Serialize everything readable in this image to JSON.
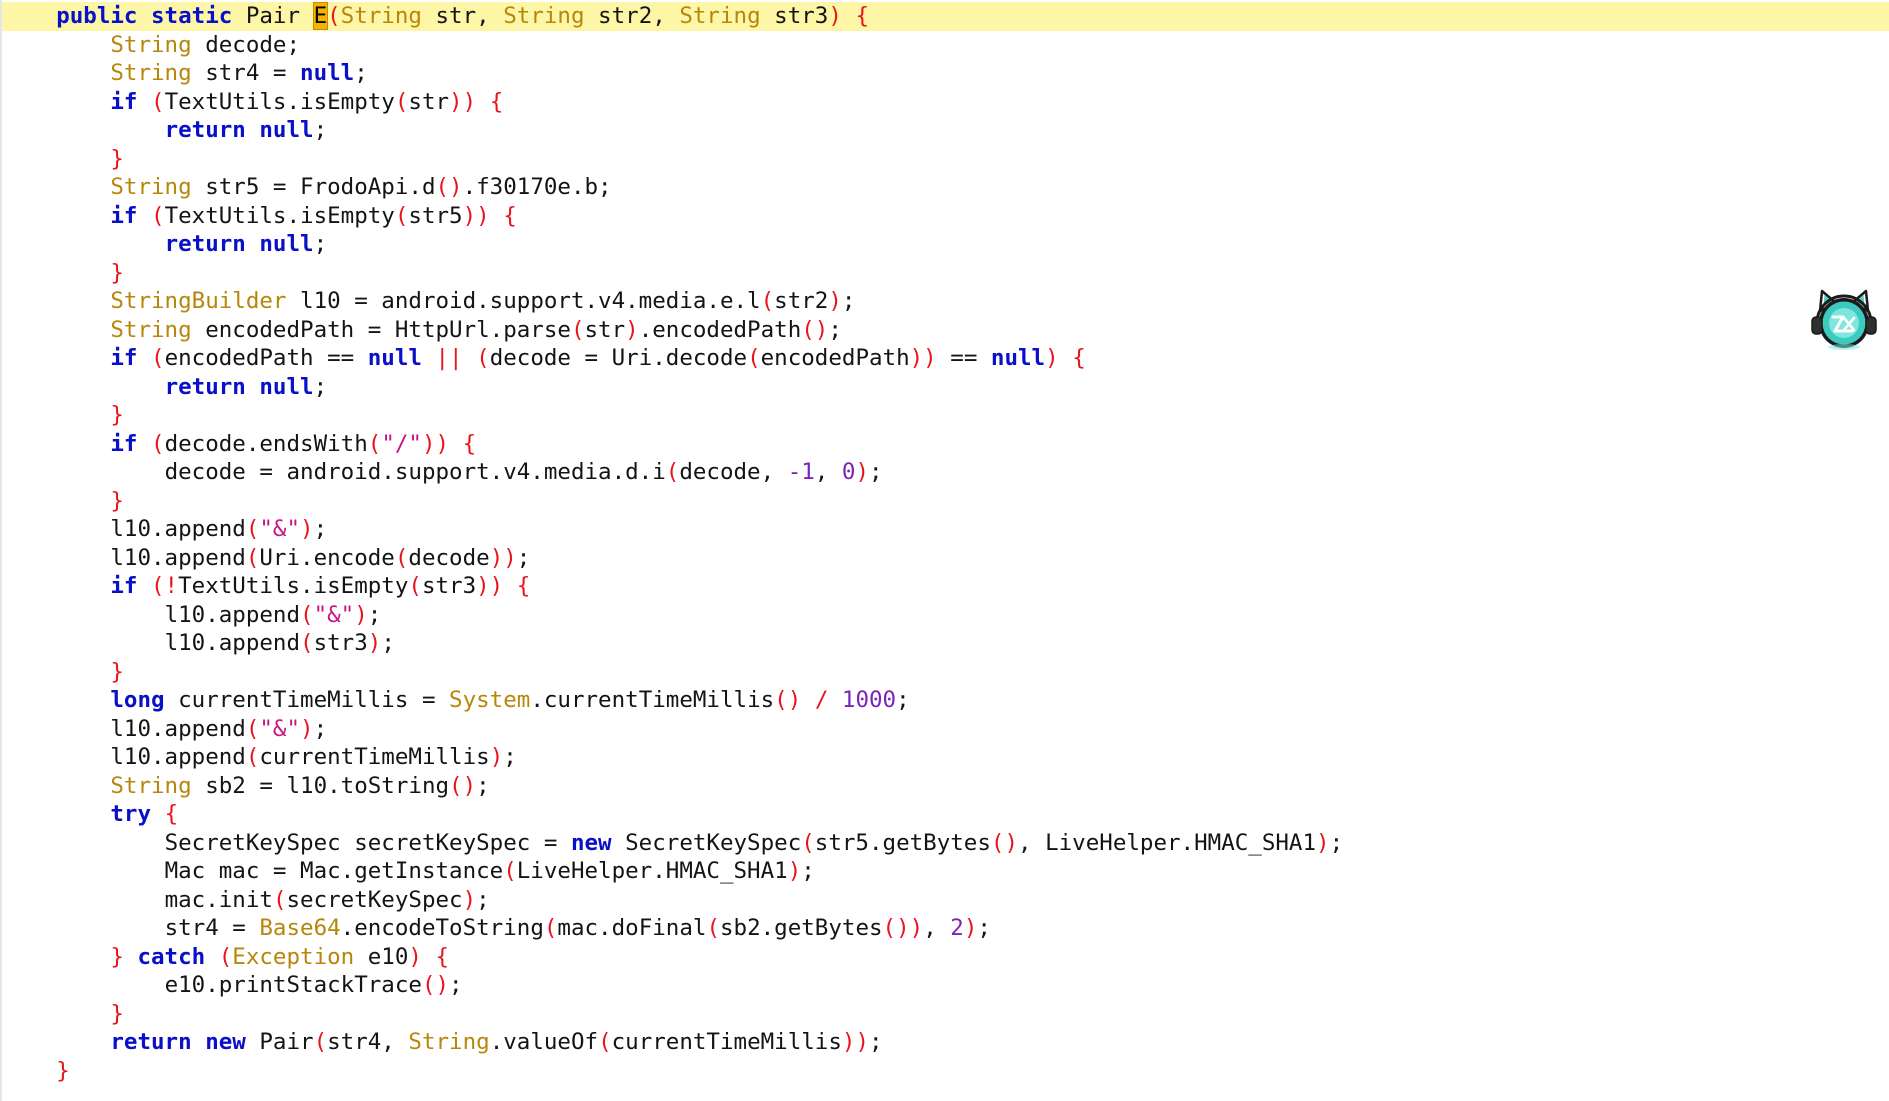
{
  "colors": {
    "keyword": "#0a10c8",
    "type": "#b8860b",
    "punctuation": "#e8141c",
    "string": "#c71585",
    "number": "#7b24b8",
    "identifier": "#141414",
    "current_line_highlight": "#fcf6a6",
    "cursor_match": "#f5b300"
  },
  "mascot": {
    "icon": "cat-headphones-logo-icon"
  },
  "lines": [
    {
      "hl": true,
      "tokens": [
        {
          "c": "sp",
          "t": "    "
        },
        {
          "c": "kw",
          "t": "public static"
        },
        {
          "c": "sp",
          "t": " "
        },
        {
          "c": "id",
          "t": "Pair"
        },
        {
          "c": "sp",
          "t": " "
        },
        {
          "c": "cur",
          "t": "E"
        },
        {
          "c": "pu",
          "t": "("
        },
        {
          "c": "ty",
          "t": "String"
        },
        {
          "c": "id",
          "t": " str, "
        },
        {
          "c": "ty",
          "t": "String"
        },
        {
          "c": "id",
          "t": " str2, "
        },
        {
          "c": "ty",
          "t": "String"
        },
        {
          "c": "id",
          "t": " str3"
        },
        {
          "c": "pu",
          "t": ")"
        },
        {
          "c": "sp",
          "t": " "
        },
        {
          "c": "pu",
          "t": "{"
        }
      ]
    },
    {
      "tokens": [
        {
          "c": "sp",
          "t": "        "
        },
        {
          "c": "ty",
          "t": "String"
        },
        {
          "c": "id",
          "t": " decode;"
        }
      ]
    },
    {
      "tokens": [
        {
          "c": "sp",
          "t": "        "
        },
        {
          "c": "ty",
          "t": "String"
        },
        {
          "c": "id",
          "t": " str4 = "
        },
        {
          "c": "kw",
          "t": "null"
        },
        {
          "c": "id",
          "t": ";"
        }
      ]
    },
    {
      "tokens": [
        {
          "c": "sp",
          "t": "        "
        },
        {
          "c": "kw",
          "t": "if"
        },
        {
          "c": "sp",
          "t": " "
        },
        {
          "c": "pu",
          "t": "("
        },
        {
          "c": "id",
          "t": "TextUtils.isEmpty"
        },
        {
          "c": "pu",
          "t": "("
        },
        {
          "c": "id",
          "t": "str"
        },
        {
          "c": "pu",
          "t": "))"
        },
        {
          "c": "sp",
          "t": " "
        },
        {
          "c": "pu",
          "t": "{"
        }
      ]
    },
    {
      "tokens": [
        {
          "c": "sp",
          "t": "            "
        },
        {
          "c": "kw",
          "t": "return null"
        },
        {
          "c": "id",
          "t": ";"
        }
      ]
    },
    {
      "tokens": [
        {
          "c": "sp",
          "t": "        "
        },
        {
          "c": "pu",
          "t": "}"
        }
      ]
    },
    {
      "tokens": [
        {
          "c": "sp",
          "t": "        "
        },
        {
          "c": "ty",
          "t": "String"
        },
        {
          "c": "id",
          "t": " str5 = FrodoApi.d"
        },
        {
          "c": "pu",
          "t": "()"
        },
        {
          "c": "id",
          "t": ".f30170e.b;"
        }
      ]
    },
    {
      "tokens": [
        {
          "c": "sp",
          "t": "        "
        },
        {
          "c": "kw",
          "t": "if"
        },
        {
          "c": "sp",
          "t": " "
        },
        {
          "c": "pu",
          "t": "("
        },
        {
          "c": "id",
          "t": "TextUtils.isEmpty"
        },
        {
          "c": "pu",
          "t": "("
        },
        {
          "c": "id",
          "t": "str5"
        },
        {
          "c": "pu",
          "t": "))"
        },
        {
          "c": "sp",
          "t": " "
        },
        {
          "c": "pu",
          "t": "{"
        }
      ]
    },
    {
      "tokens": [
        {
          "c": "sp",
          "t": "            "
        },
        {
          "c": "kw",
          "t": "return null"
        },
        {
          "c": "id",
          "t": ";"
        }
      ]
    },
    {
      "tokens": [
        {
          "c": "sp",
          "t": "        "
        },
        {
          "c": "pu",
          "t": "}"
        }
      ]
    },
    {
      "tokens": [
        {
          "c": "sp",
          "t": "        "
        },
        {
          "c": "ty",
          "t": "StringBuilder"
        },
        {
          "c": "id",
          "t": " l10 = android.support.v4.media.e.l"
        },
        {
          "c": "pu",
          "t": "("
        },
        {
          "c": "id",
          "t": "str2"
        },
        {
          "c": "pu",
          "t": ")"
        },
        {
          "c": "id",
          "t": ";"
        }
      ]
    },
    {
      "tokens": [
        {
          "c": "sp",
          "t": "        "
        },
        {
          "c": "ty",
          "t": "String"
        },
        {
          "c": "id",
          "t": " encodedPath = HttpUrl.parse"
        },
        {
          "c": "pu",
          "t": "("
        },
        {
          "c": "id",
          "t": "str"
        },
        {
          "c": "pu",
          "t": ")"
        },
        {
          "c": "id",
          "t": ".encodedPath"
        },
        {
          "c": "pu",
          "t": "()"
        },
        {
          "c": "id",
          "t": ";"
        }
      ]
    },
    {
      "tokens": [
        {
          "c": "sp",
          "t": "        "
        },
        {
          "c": "kw",
          "t": "if"
        },
        {
          "c": "sp",
          "t": " "
        },
        {
          "c": "pu",
          "t": "("
        },
        {
          "c": "id",
          "t": "encodedPath == "
        },
        {
          "c": "kw",
          "t": "null"
        },
        {
          "c": "sp",
          "t": " "
        },
        {
          "c": "pu",
          "t": "||"
        },
        {
          "c": "sp",
          "t": " "
        },
        {
          "c": "pu",
          "t": "("
        },
        {
          "c": "id",
          "t": "decode = Uri.decode"
        },
        {
          "c": "pu",
          "t": "("
        },
        {
          "c": "id",
          "t": "encodedPath"
        },
        {
          "c": "pu",
          "t": "))"
        },
        {
          "c": "id",
          "t": " == "
        },
        {
          "c": "kw",
          "t": "null"
        },
        {
          "c": "pu",
          "t": ")"
        },
        {
          "c": "sp",
          "t": " "
        },
        {
          "c": "pu",
          "t": "{"
        }
      ]
    },
    {
      "tokens": [
        {
          "c": "sp",
          "t": "            "
        },
        {
          "c": "kw",
          "t": "return null"
        },
        {
          "c": "id",
          "t": ";"
        }
      ]
    },
    {
      "tokens": [
        {
          "c": "sp",
          "t": "        "
        },
        {
          "c": "pu",
          "t": "}"
        }
      ]
    },
    {
      "tokens": [
        {
          "c": "sp",
          "t": "        "
        },
        {
          "c": "kw",
          "t": "if"
        },
        {
          "c": "sp",
          "t": " "
        },
        {
          "c": "pu",
          "t": "("
        },
        {
          "c": "id",
          "t": "decode.endsWith"
        },
        {
          "c": "pu",
          "t": "("
        },
        {
          "c": "st",
          "t": "\"/\""
        },
        {
          "c": "pu",
          "t": "))"
        },
        {
          "c": "sp",
          "t": " "
        },
        {
          "c": "pu",
          "t": "{"
        }
      ]
    },
    {
      "tokens": [
        {
          "c": "sp",
          "t": "            "
        },
        {
          "c": "id",
          "t": "decode = android.support.v4.media.d.i"
        },
        {
          "c": "pu",
          "t": "("
        },
        {
          "c": "id",
          "t": "decode, "
        },
        {
          "c": "nu",
          "t": "-1"
        },
        {
          "c": "id",
          "t": ", "
        },
        {
          "c": "nu",
          "t": "0"
        },
        {
          "c": "pu",
          "t": ")"
        },
        {
          "c": "id",
          "t": ";"
        }
      ]
    },
    {
      "tokens": [
        {
          "c": "sp",
          "t": "        "
        },
        {
          "c": "pu",
          "t": "}"
        }
      ]
    },
    {
      "tokens": [
        {
          "c": "sp",
          "t": "        "
        },
        {
          "c": "id",
          "t": "l10.append"
        },
        {
          "c": "pu",
          "t": "("
        },
        {
          "c": "st",
          "t": "\"&\""
        },
        {
          "c": "pu",
          "t": ")"
        },
        {
          "c": "id",
          "t": ";"
        }
      ]
    },
    {
      "tokens": [
        {
          "c": "sp",
          "t": "        "
        },
        {
          "c": "id",
          "t": "l10.append"
        },
        {
          "c": "pu",
          "t": "("
        },
        {
          "c": "id",
          "t": "Uri.encode"
        },
        {
          "c": "pu",
          "t": "("
        },
        {
          "c": "id",
          "t": "decode"
        },
        {
          "c": "pu",
          "t": "))"
        },
        {
          "c": "id",
          "t": ";"
        }
      ]
    },
    {
      "tokens": [
        {
          "c": "sp",
          "t": "        "
        },
        {
          "c": "kw",
          "t": "if"
        },
        {
          "c": "sp",
          "t": " "
        },
        {
          "c": "pu",
          "t": "(!"
        },
        {
          "c": "id",
          "t": "TextUtils.isEmpty"
        },
        {
          "c": "pu",
          "t": "("
        },
        {
          "c": "id",
          "t": "str3"
        },
        {
          "c": "pu",
          "t": "))"
        },
        {
          "c": "sp",
          "t": " "
        },
        {
          "c": "pu",
          "t": "{"
        }
      ]
    },
    {
      "tokens": [
        {
          "c": "sp",
          "t": "            "
        },
        {
          "c": "id",
          "t": "l10.append"
        },
        {
          "c": "pu",
          "t": "("
        },
        {
          "c": "st",
          "t": "\"&\""
        },
        {
          "c": "pu",
          "t": ")"
        },
        {
          "c": "id",
          "t": ";"
        }
      ]
    },
    {
      "tokens": [
        {
          "c": "sp",
          "t": "            "
        },
        {
          "c": "id",
          "t": "l10.append"
        },
        {
          "c": "pu",
          "t": "("
        },
        {
          "c": "id",
          "t": "str3"
        },
        {
          "c": "pu",
          "t": ")"
        },
        {
          "c": "id",
          "t": ";"
        }
      ]
    },
    {
      "tokens": [
        {
          "c": "sp",
          "t": "        "
        },
        {
          "c": "pu",
          "t": "}"
        }
      ]
    },
    {
      "tokens": [
        {
          "c": "sp",
          "t": "        "
        },
        {
          "c": "kw",
          "t": "long"
        },
        {
          "c": "id",
          "t": " currentTimeMillis = "
        },
        {
          "c": "ty",
          "t": "System"
        },
        {
          "c": "id",
          "t": ".currentTimeMillis"
        },
        {
          "c": "pu",
          "t": "()"
        },
        {
          "c": "sp",
          "t": " "
        },
        {
          "c": "pu",
          "t": "/"
        },
        {
          "c": "sp",
          "t": " "
        },
        {
          "c": "nu",
          "t": "1000"
        },
        {
          "c": "id",
          "t": ";"
        }
      ]
    },
    {
      "tokens": [
        {
          "c": "sp",
          "t": "        "
        },
        {
          "c": "id",
          "t": "l10.append"
        },
        {
          "c": "pu",
          "t": "("
        },
        {
          "c": "st",
          "t": "\"&\""
        },
        {
          "c": "pu",
          "t": ")"
        },
        {
          "c": "id",
          "t": ";"
        }
      ]
    },
    {
      "tokens": [
        {
          "c": "sp",
          "t": "        "
        },
        {
          "c": "id",
          "t": "l10.append"
        },
        {
          "c": "pu",
          "t": "("
        },
        {
          "c": "id",
          "t": "currentTimeMillis"
        },
        {
          "c": "pu",
          "t": ")"
        },
        {
          "c": "id",
          "t": ";"
        }
      ]
    },
    {
      "tokens": [
        {
          "c": "sp",
          "t": "        "
        },
        {
          "c": "ty",
          "t": "String"
        },
        {
          "c": "id",
          "t": " sb2 = l10.toString"
        },
        {
          "c": "pu",
          "t": "()"
        },
        {
          "c": "id",
          "t": ";"
        }
      ]
    },
    {
      "tokens": [
        {
          "c": "sp",
          "t": "        "
        },
        {
          "c": "kw",
          "t": "try"
        },
        {
          "c": "sp",
          "t": " "
        },
        {
          "c": "pu",
          "t": "{"
        }
      ]
    },
    {
      "tokens": [
        {
          "c": "sp",
          "t": "            "
        },
        {
          "c": "id",
          "t": "SecretKeySpec secretKeySpec = "
        },
        {
          "c": "kw",
          "t": "new"
        },
        {
          "c": "id",
          "t": " SecretKeySpec"
        },
        {
          "c": "pu",
          "t": "("
        },
        {
          "c": "id",
          "t": "str5.getBytes"
        },
        {
          "c": "pu",
          "t": "()"
        },
        {
          "c": "id",
          "t": ", LiveHelper.HMAC_SHA1"
        },
        {
          "c": "pu",
          "t": ")"
        },
        {
          "c": "id",
          "t": ";"
        }
      ]
    },
    {
      "tokens": [
        {
          "c": "sp",
          "t": "            "
        },
        {
          "c": "id",
          "t": "Mac mac = Mac.getInstance"
        },
        {
          "c": "pu",
          "t": "("
        },
        {
          "c": "id",
          "t": "LiveHelper.HMAC_SHA1"
        },
        {
          "c": "pu",
          "t": ")"
        },
        {
          "c": "id",
          "t": ";"
        }
      ]
    },
    {
      "tokens": [
        {
          "c": "sp",
          "t": "            "
        },
        {
          "c": "id",
          "t": "mac.init"
        },
        {
          "c": "pu",
          "t": "("
        },
        {
          "c": "id",
          "t": "secretKeySpec"
        },
        {
          "c": "pu",
          "t": ")"
        },
        {
          "c": "id",
          "t": ";"
        }
      ]
    },
    {
      "tokens": [
        {
          "c": "sp",
          "t": "            "
        },
        {
          "c": "id",
          "t": "str4 = "
        },
        {
          "c": "ty",
          "t": "Base64"
        },
        {
          "c": "id",
          "t": ".encodeToString"
        },
        {
          "c": "pu",
          "t": "("
        },
        {
          "c": "id",
          "t": "mac.doFinal"
        },
        {
          "c": "pu",
          "t": "("
        },
        {
          "c": "id",
          "t": "sb2.getBytes"
        },
        {
          "c": "pu",
          "t": "())"
        },
        {
          "c": "id",
          "t": ", "
        },
        {
          "c": "nu",
          "t": "2"
        },
        {
          "c": "pu",
          "t": ")"
        },
        {
          "c": "id",
          "t": ";"
        }
      ]
    },
    {
      "tokens": [
        {
          "c": "sp",
          "t": "        "
        },
        {
          "c": "pu",
          "t": "}"
        },
        {
          "c": "sp",
          "t": " "
        },
        {
          "c": "kw",
          "t": "catch"
        },
        {
          "c": "sp",
          "t": " "
        },
        {
          "c": "pu",
          "t": "("
        },
        {
          "c": "ty",
          "t": "Exception"
        },
        {
          "c": "id",
          "t": " e10"
        },
        {
          "c": "pu",
          "t": ")"
        },
        {
          "c": "sp",
          "t": " "
        },
        {
          "c": "pu",
          "t": "{"
        }
      ]
    },
    {
      "tokens": [
        {
          "c": "sp",
          "t": "            "
        },
        {
          "c": "id",
          "t": "e10.printStackTrace"
        },
        {
          "c": "pu",
          "t": "()"
        },
        {
          "c": "id",
          "t": ";"
        }
      ]
    },
    {
      "tokens": [
        {
          "c": "sp",
          "t": "        "
        },
        {
          "c": "pu",
          "t": "}"
        }
      ]
    },
    {
      "tokens": [
        {
          "c": "sp",
          "t": "        "
        },
        {
          "c": "kw",
          "t": "return new"
        },
        {
          "c": "id",
          "t": " Pair"
        },
        {
          "c": "pu",
          "t": "("
        },
        {
          "c": "id",
          "t": "str4, "
        },
        {
          "c": "ty",
          "t": "String"
        },
        {
          "c": "id",
          "t": ".valueOf"
        },
        {
          "c": "pu",
          "t": "("
        },
        {
          "c": "id",
          "t": "currentTimeMillis"
        },
        {
          "c": "pu",
          "t": "))"
        },
        {
          "c": "id",
          "t": ";"
        }
      ]
    },
    {
      "tokens": [
        {
          "c": "sp",
          "t": "    "
        },
        {
          "c": "pu",
          "t": "}"
        }
      ]
    }
  ]
}
